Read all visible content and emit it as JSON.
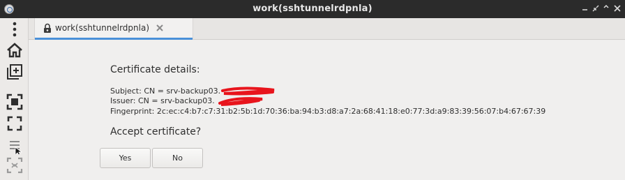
{
  "window": {
    "title": "work(sshtunnelrdpnla)",
    "controls": [
      "minimize-icon",
      "restore-icon",
      "maximize-icon",
      "close-icon"
    ]
  },
  "sidebar": {
    "items": [
      "more-vert-icon",
      "home-icon",
      "new-tab-icon",
      "screenshot-icon",
      "fullscreen-icon",
      "menu-icon",
      "scale-icon"
    ]
  },
  "tab": {
    "label": "work(sshtunnelrdpnla)",
    "icons": [
      "lock-icon",
      "close-icon"
    ],
    "accent": "#4a90d9"
  },
  "dialog": {
    "heading": "Certificate details:",
    "subject": "Subject: CN = srv-backup03.",
    "issuer": "Issuer: CN = srv-backup03.",
    "fingerprint": "Fingerprint: 2c:ec:c4:b7:c7:31:b2:5b:1d:70:36:ba:94:b3:d8:a7:2a:68:41:18:e0:77:3d:a9:83:39:56:07:b4:67:67:39",
    "question": "Accept certificate?",
    "yes_label": "Yes",
    "no_label": "No",
    "redaction_color": "#e8141c"
  }
}
